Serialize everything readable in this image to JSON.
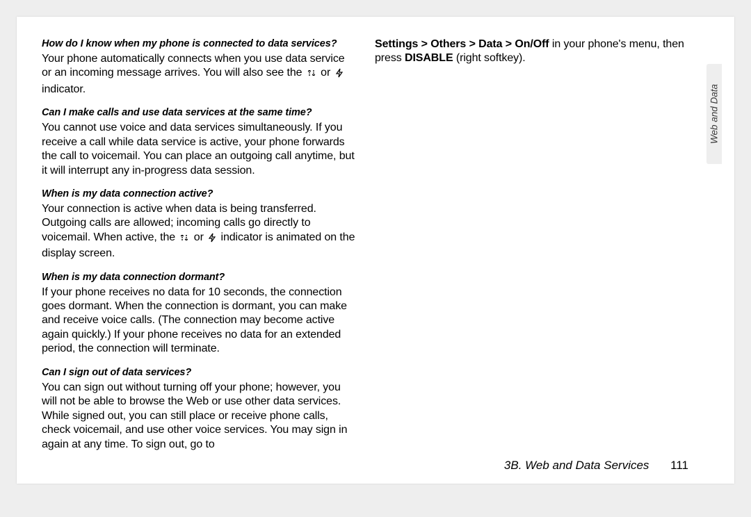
{
  "sidetab": "Web and Data",
  "footer": {
    "section": "3B. Web and Data Services",
    "page": "111"
  },
  "faq": [
    {
      "q": "How do I know when my phone is connected to data services?",
      "a_pre": "Your phone automatically connects when you use data service or an incoming message arrives. You will also see the ",
      "a_mid": " or ",
      "a_post": " indicator."
    },
    {
      "q": "Can I make calls and use data services at the same time?",
      "a": "You cannot use voice and data services simultaneously. If you receive a call while data service is active, your phone forwards the call to voicemail. You can place an outgoing call anytime, but it will interrupt any in-progress data session."
    },
    {
      "q": "When is my data connection active?",
      "a_pre": "Your connection is active when data is being transferred. Outgoing calls are allowed; incoming calls go directly to voicemail. When active, the ",
      "a_mid": " or ",
      "a_post": " indicator is animated on the display screen."
    },
    {
      "q": "When is my data connection dormant?",
      "a": "If your phone receives no data for 10 seconds, the connection goes dormant. When the connection is dormant, you can make and receive voice calls. (The connection may become active again quickly.) If your phone receives no data for an extended period, the connection will terminate."
    },
    {
      "q": "Can I sign out of data services?",
      "a_pre": "You can sign out without turning off your phone; however, you will not be able to browse the Web or use other data services. While signed out, you can still place or receive phone calls, check voicemail, and use other voice services. You may sign in again at any time. To sign out, go to ",
      "a_bold1": "Settings > Others > Data > On/Off",
      "a_mid": " in your phone's menu, then press ",
      "a_bold2": "DISABLE",
      "a_post": " (right softkey)."
    }
  ]
}
